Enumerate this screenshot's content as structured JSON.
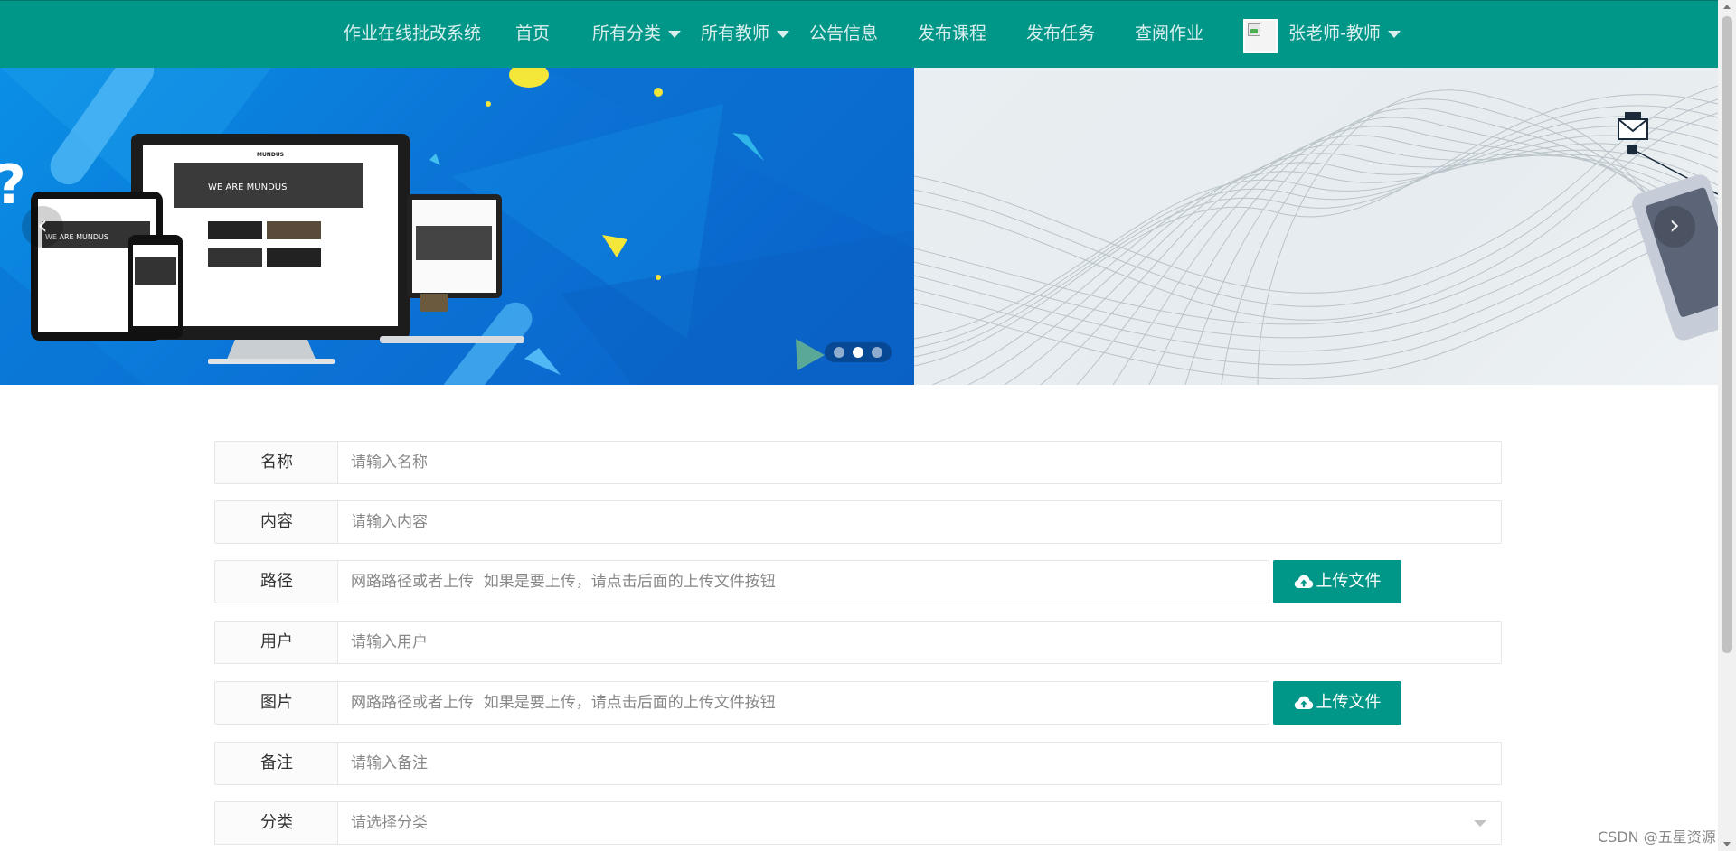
{
  "nav": {
    "brand": "作业在线批改系统",
    "home": "首页",
    "categories": "所有分类",
    "teachers": "所有教师",
    "notices": "公告信息",
    "publish_course": "发布课程",
    "publish_task": "发布任务",
    "view_homework": "查阅作业",
    "user": "张老师-教师"
  },
  "carousel": {
    "prev_label": "‹",
    "next_label": "›",
    "slide_text": "WE ARE MUNDUS",
    "slide_brand": "MUNDUS",
    "active_slide": 2,
    "slide_count": 3
  },
  "form": {
    "name": {
      "label": "名称",
      "placeholder": "请输入名称"
    },
    "content": {
      "label": "内容",
      "placeholder": "请输入内容"
    },
    "path": {
      "label": "路径",
      "placeholder": "网路路径或者上传  如果是要上传，请点击后面的上传文件按钮",
      "button": "上传文件"
    },
    "user": {
      "label": "用户",
      "placeholder": "请输入用户"
    },
    "image": {
      "label": "图片",
      "placeholder": "网路路径或者上传  如果是要上传，请点击后面的上传文件按钮",
      "button": "上传文件"
    },
    "remark": {
      "label": "备注",
      "placeholder": "请输入备注"
    },
    "category": {
      "label": "分类",
      "placeholder": "请选择分类"
    }
  },
  "watermark": "CSDN @五星资源",
  "colors": {
    "primary": "#009688",
    "slide_blue": "#0b74d6"
  }
}
